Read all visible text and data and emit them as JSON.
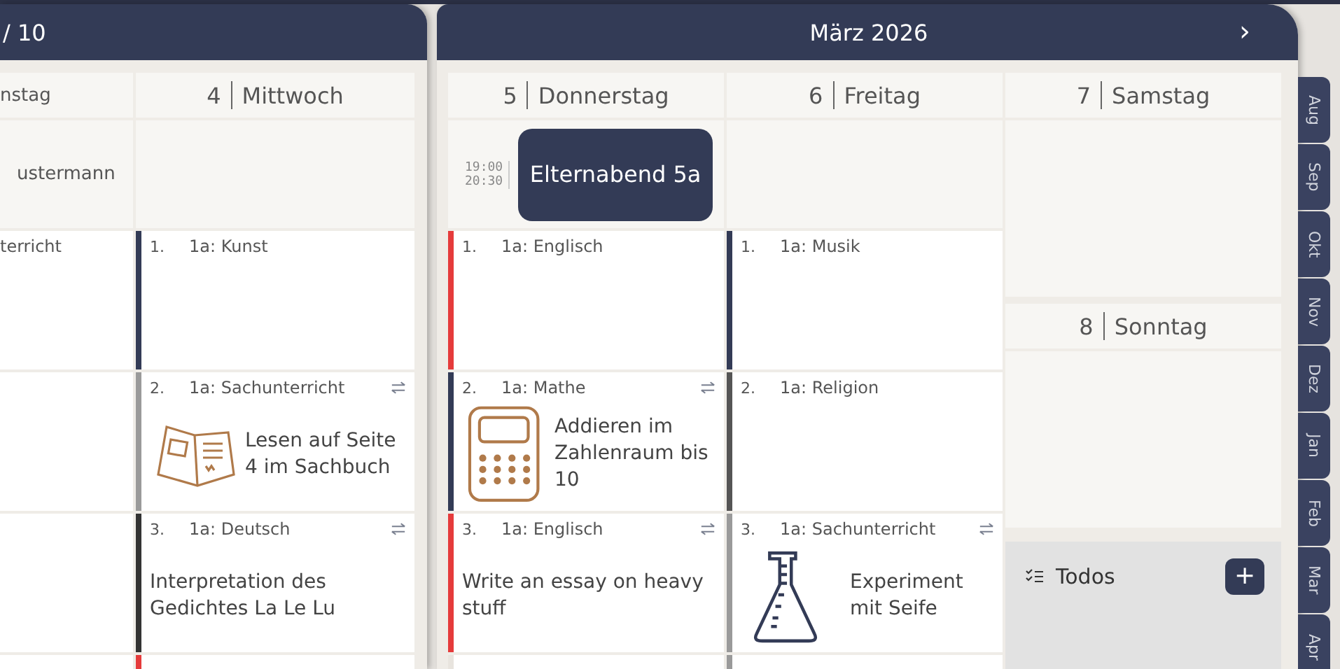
{
  "left_page": {
    "title": "/ 10",
    "partial_column": {
      "header": "nstag",
      "event": "ustermann",
      "lesson": "terricht"
    },
    "columns": [
      {
        "day": "4",
        "weekday": "Mittwoch",
        "lessons": [
          {
            "kind": "plain",
            "number": "1.",
            "subject": "1a: Kunst",
            "color": "#333b56",
            "swappable": false
          },
          {
            "kind": "book",
            "number": "2.",
            "subject": "1a: Sachunterricht",
            "color": "#9a9a9a",
            "swappable": true,
            "note": "Lesen auf Seite 4 im Sachbuch"
          },
          {
            "kind": "plain",
            "number": "3.",
            "subject": "1a: Deutsch",
            "color": "#333333",
            "swappable": true,
            "note": "Interpretation des Gedichtes La Le Lu"
          },
          {
            "kind": "partial",
            "color": "#e53b3b"
          }
        ]
      }
    ]
  },
  "right_page": {
    "title": "März 2026",
    "next": "›",
    "columns": [
      {
        "day": "5",
        "weekday": "Donnerstag",
        "event": {
          "start": "19:00",
          "end": "20:30",
          "title": "Elternabend 5a"
        },
        "lessons": [
          {
            "kind": "plain",
            "number": "1.",
            "subject": "1a: Englisch",
            "color": "#e53b3b",
            "swappable": false
          },
          {
            "kind": "calculator",
            "number": "2.",
            "subject": "1a: Mathe",
            "color": "#333b56",
            "swappable": true,
            "note": "Addieren im Zahlenraum bis 10"
          },
          {
            "kind": "plain",
            "number": "3.",
            "subject": "1a: Englisch",
            "color": "#e53b3b",
            "swappable": true,
            "note": "Write an essay on heavy stuff"
          },
          {
            "kind": "partial",
            "color": "#e8e4de"
          }
        ]
      },
      {
        "day": "6",
        "weekday": "Freitag",
        "lessons": [
          {
            "kind": "plain",
            "number": "1.",
            "subject": "1a: Musik",
            "color": "#333b56",
            "swappable": false
          },
          {
            "kind": "plain",
            "number": "2.",
            "subject": "1a: Religion",
            "color": "#555555",
            "swappable": false
          },
          {
            "kind": "flask",
            "number": "3.",
            "subject": "1a: Sachunterricht",
            "color": "#9a9a9a",
            "swappable": true,
            "note": "Experiment mit Seife"
          },
          {
            "kind": "partial",
            "color": "#9a9a9a"
          }
        ]
      }
    ],
    "weekend": [
      {
        "day": "7",
        "weekday": "Samstag"
      },
      {
        "day": "8",
        "weekday": "Sonntag"
      }
    ],
    "todos": {
      "title": "Todos",
      "add": "+"
    }
  },
  "month_tabs": [
    "Aug",
    "Sep",
    "Okt",
    "Nov",
    "Dez",
    "Jan",
    "Feb",
    "Mar",
    "Apr"
  ]
}
